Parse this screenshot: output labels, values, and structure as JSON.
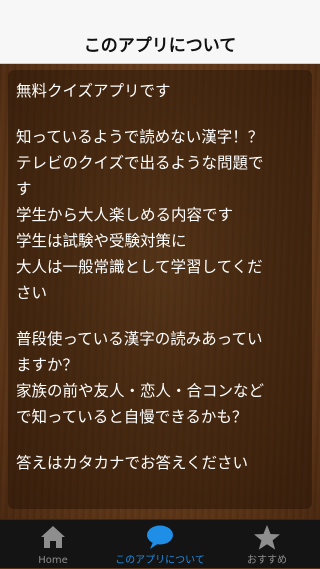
{
  "nav": {
    "title": "このアプリについて"
  },
  "body": {
    "lines": [
      "無料クイズアプリです",
      "",
      "知っているようで読めない漢字！？",
      "テレビのクイズで出るような問題で",
      "す",
      "学生から大人楽しめる内容です",
      "学生は試験や受験対策に",
      "大人は一般常識として学習してくだ",
      "さい",
      "",
      "普段使っている漢字の読みあってい",
      "ますか？",
      "家族の前や友人・恋人・合コンなど",
      "で知っていると自慢できるかも？",
      "",
      "答えはカタカナでお答えください"
    ]
  },
  "tabbar": {
    "tabs": [
      {
        "label": "Home",
        "icon": "home-icon",
        "active": false
      },
      {
        "label": "このアプリについて",
        "icon": "speech-bubble-icon",
        "active": true
      },
      {
        "label": "おすすめ",
        "icon": "star-icon",
        "active": false
      }
    ]
  },
  "colors": {
    "active_tab": "#1e8ee6",
    "inactive_tab": "#8e8e8e",
    "wood": "#6b3f1c"
  }
}
